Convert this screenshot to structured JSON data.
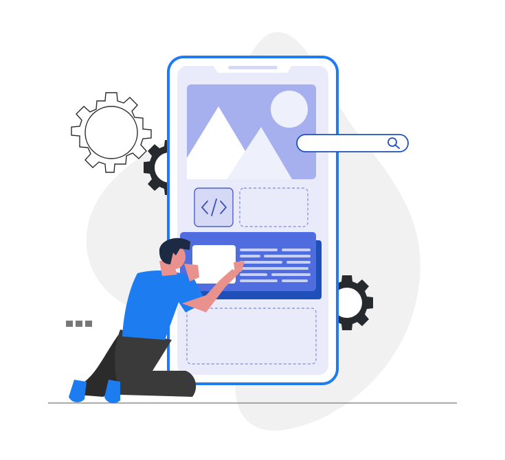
{
  "illustration": {
    "icons": {
      "code": "code-brackets-icon",
      "search": "search-icon",
      "gear": "gear-icon",
      "image": "image-placeholder-icon"
    },
    "colors": {
      "accent": "#1a72e8",
      "phone_outline": "#1e7bf2",
      "screen_bg": "#e9ebfb",
      "image_panel": "#a7b0ef",
      "card_blue": "#4f6ddf",
      "card_shadow": "#1f4fb8",
      "blob_gray": "#f1f1f1",
      "gear_dark": "#26292e",
      "person_shirt": "#1c7cf0",
      "person_pants": "#2b2b2b",
      "person_skin": "#e8918d",
      "hair": "#1d2a44",
      "ground_line": "#777777"
    }
  }
}
